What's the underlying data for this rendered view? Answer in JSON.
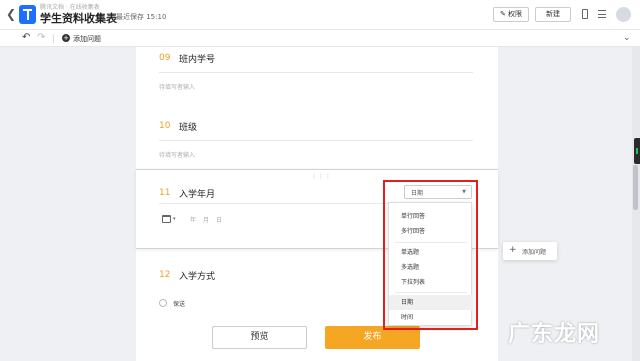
{
  "header": {
    "owner_label": "腾讯文档 · 在线收集表",
    "title": "学生资料收集表",
    "save_status": "最近保存 15:10",
    "permission_label": "权限",
    "new_label": "新建"
  },
  "toolbar": {
    "add_question_label": "添加问题"
  },
  "questions": [
    {
      "number": "09",
      "title": "班内学号",
      "placeholder": "待填写者输入"
    },
    {
      "number": "10",
      "title": "班级",
      "placeholder": "待填写者输入"
    },
    {
      "number": "11",
      "title": "入学年月",
      "type_value": "日期",
      "year": "年",
      "month": "月",
      "day": "日"
    },
    {
      "number": "12",
      "title": "入学方式",
      "option": "保送"
    }
  ],
  "drag_handle": "⋮⋮⋮",
  "type_menu": {
    "groups": [
      [
        "单行回答",
        "多行回答"
      ],
      [
        "单选题",
        "多选题",
        "下拉列表"
      ],
      [
        "日期",
        "时间"
      ]
    ],
    "selected": "日期"
  },
  "float_add_label": "添加问题",
  "footer": {
    "preview_label": "预览",
    "publish_label": "发布"
  },
  "watermark": "广东龙网",
  "colors": {
    "accent": "#f5a623",
    "highlight": "#e02020",
    "brand": "#1f6fff"
  }
}
